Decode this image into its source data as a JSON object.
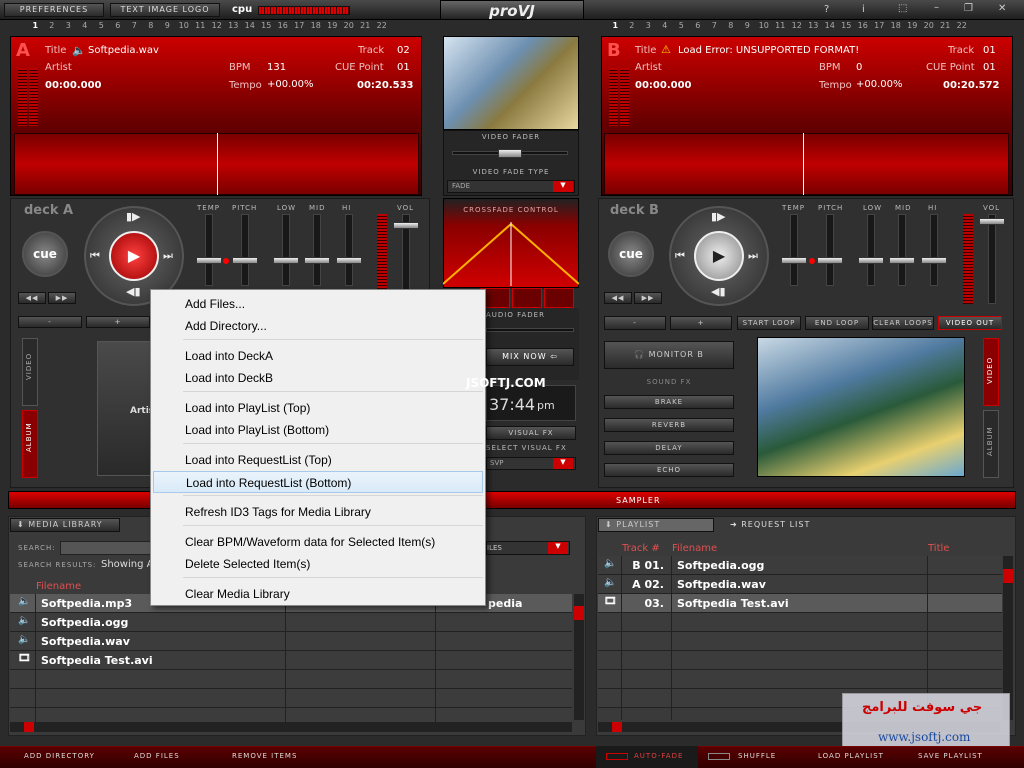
{
  "topbar": {
    "preferences": "PREFERENCES",
    "text_logo": "TEXT IMAGE LOGO",
    "cpu": "cpu",
    "logo": "proVJ",
    "win_help": "?",
    "win_i": "i",
    "win_max": "⬚",
    "win_min": "–",
    "win_restore": "❐",
    "win_close": "✕"
  },
  "cues_left": [
    "1",
    "2",
    "3",
    "4",
    "5",
    "6",
    "7",
    "8",
    "9",
    "10",
    "11",
    "12",
    "13",
    "14",
    "15",
    "16",
    "17",
    "18",
    "19",
    "20",
    "21",
    "22"
  ],
  "deckA": {
    "letter": "A",
    "title_label": "Title",
    "title": "Softpedia.wav",
    "track_label": "Track",
    "track": "02",
    "artist_label": "Artist",
    "bpm_label": "BPM",
    "bpm": "131",
    "cue_label": "CUE Point",
    "cue": "01",
    "time": "00:00.000",
    "tempo_label": "Tempo",
    "tempo": "+00.00%",
    "remaining": "00:20.533",
    "name": "deck A"
  },
  "deckB": {
    "letter": "B",
    "title_label": "Title",
    "title": "Load Error: UNSUPPORTED FORMAT!",
    "track_label": "Track",
    "track": "01",
    "artist_label": "Artist",
    "bpm_label": "BPM",
    "bpm": "0",
    "cue_label": "CUE Point",
    "cue": "01",
    "time": "00:00.000",
    "tempo_label": "Tempo",
    "tempo": "+00.00%",
    "remaining": "00:20.572",
    "name": "deck B"
  },
  "eq": {
    "temp": "TEMP",
    "pitch": "PITCH",
    "low": "LOW",
    "mid": "MID",
    "hi": "HI",
    "vol": "VOL"
  },
  "cue_btn": "cue",
  "center": {
    "video_fader": "VIDEO FADER",
    "video_fade_type": "VIDEO FADE TYPE",
    "fade": "FADE",
    "crossfade": "CROSSFADE CONTROL",
    "audio_fader": "AUDIO FADER",
    "mix_now": "MIX NOW",
    "clock": "37:44",
    "pm": "pm",
    "visual_fx": "VISUAL FX",
    "select_vfx": "SELECT VISUAL FX",
    "svp": "SVP"
  },
  "deckB_controls": {
    "minus": "-",
    "plus": "+",
    "start_loop": "START LOOP",
    "end_loop": "END LOOP",
    "clear_loops": "CLEAR LOOPS",
    "video_out": "VIDEO OUT",
    "monitor": "MONITOR B",
    "sound_fx": "SOUND FX",
    "brake": "BRAKE",
    "reverb": "REVERB",
    "delay": "DELAY",
    "echo": "ECHO",
    "video_tab": "VIDEO",
    "album_tab": "ALBUM"
  },
  "deckA_controls": {
    "minus": "-",
    "plus": "+",
    "video_tab": "VIDEO",
    "album_tab": "ALBUM",
    "artist_partial": "Artis"
  },
  "watermark": "JSOFTJ.COM",
  "sampler": "SAMPLER",
  "media": {
    "tab": "MEDIA LIBRARY",
    "search_label": "SEARCH:",
    "results_label": "SEARCH RESULTS:",
    "results_value": "Showing A",
    "filter": "ILES",
    "col_filename": "Filename",
    "rows": [
      "Softpedia.mp3",
      "Softpedia.ogg",
      "Softpedia.wav",
      "Softpedia Test.avi"
    ],
    "row0_extra": "pedia"
  },
  "playlist": {
    "tab": "PLAYLIST",
    "request_tab": "REQUEST LIST",
    "col_track": "Track #",
    "col_filename": "Filename",
    "col_title": "Title",
    "rows": [
      {
        "track": "B 01.",
        "file": "Softpedia.ogg"
      },
      {
        "track": "A 02.",
        "file": "Softpedia.wav"
      },
      {
        "track": "03.",
        "file": "Softpedia Test.avi"
      }
    ]
  },
  "menu": [
    "Add Files...",
    "Add Directory...",
    "Load into DeckA",
    "Load into DeckB",
    "Load into PlayList (Top)",
    "Load into PlayList (Bottom)",
    "Load into RequestList (Top)",
    "Load into RequestList (Bottom)",
    "Refresh ID3 Tags for Media Library",
    "Clear BPM/Waveform data for Selected Item(s)",
    "Delete Selected Item(s)",
    "Clear Media Library"
  ],
  "bottom": {
    "add_dir": "ADD DIRECTORY",
    "add_files": "ADD FILES",
    "remove": "REMOVE ITEMS",
    "autofade": "AUTO-FADE",
    "shuffle": "SHUFFLE",
    "load_pl": "LOAD PLAYLIST",
    "save_pl": "SAVE PLAYLIST"
  },
  "jsoftj": {
    "arabic": "جي سوفت للبرامج",
    "url": "www.jsoftj.com"
  },
  "colors": {
    "accent": "#c00000",
    "deck_bg": "#8a0000"
  }
}
